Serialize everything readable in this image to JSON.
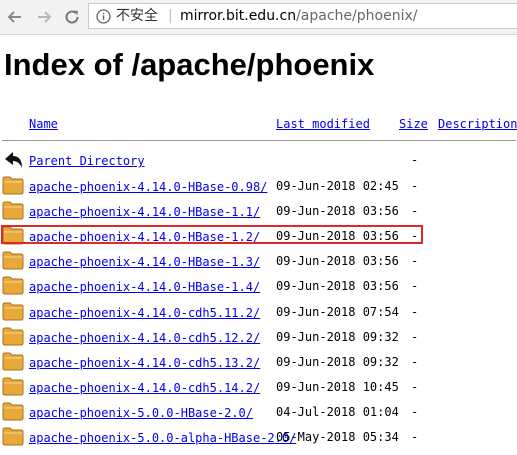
{
  "browser": {
    "security_label": "不安全",
    "url_host": "mirror.bit.edu.cn",
    "url_path": "/apache/phoenix/"
  },
  "page": {
    "title": "Index of /apache/phoenix"
  },
  "table": {
    "headers": {
      "name": "Name",
      "last_modified": "Last modified",
      "size": "Size",
      "description": "Description"
    },
    "parent": {
      "name": "Parent Directory",
      "size": "-"
    },
    "rows": [
      {
        "name": "apache-phoenix-4.14.0-HBase-0.98/",
        "date": "09-Jun-2018 02:45",
        "size": "-"
      },
      {
        "name": "apache-phoenix-4.14.0-HBase-1.1/",
        "date": "09-Jun-2018 03:56",
        "size": "-"
      },
      {
        "name": "apache-phoenix-4.14.0-HBase-1.2/",
        "date": "09-Jun-2018 03:56",
        "size": "-"
      },
      {
        "name": "apache-phoenix-4.14.0-HBase-1.3/",
        "date": "09-Jun-2018 03:56",
        "size": "-"
      },
      {
        "name": "apache-phoenix-4.14.0-HBase-1.4/",
        "date": "09-Jun-2018 03:56",
        "size": "-"
      },
      {
        "name": "apache-phoenix-4.14.0-cdh5.11.2/",
        "date": "09-Jun-2018 07:54",
        "size": "-"
      },
      {
        "name": "apache-phoenix-4.14.0-cdh5.12.2/",
        "date": "09-Jun-2018 09:32",
        "size": "-"
      },
      {
        "name": "apache-phoenix-4.14.0-cdh5.13.2/",
        "date": "09-Jun-2018 09:32",
        "size": "-"
      },
      {
        "name": "apache-phoenix-4.14.0-cdh5.14.2/",
        "date": "09-Jun-2018 10:45",
        "size": "-"
      },
      {
        "name": "apache-phoenix-5.0.0-HBase-2.0/",
        "date": "04-Jul-2018 01:04",
        "size": "-"
      },
      {
        "name": "apache-phoenix-5.0.0-alpha-HBase-2.0/",
        "date": "05-May-2018 05:34",
        "size": "-"
      }
    ]
  },
  "colors": {
    "link": "#0000ee",
    "highlight_border": "#e0282b",
    "folder": "#e8a93a"
  },
  "icons": [
    "back-arrow-icon",
    "forward-arrow-icon",
    "reload-icon",
    "info-icon",
    "parent-directory-icon",
    "folder-icon"
  ]
}
